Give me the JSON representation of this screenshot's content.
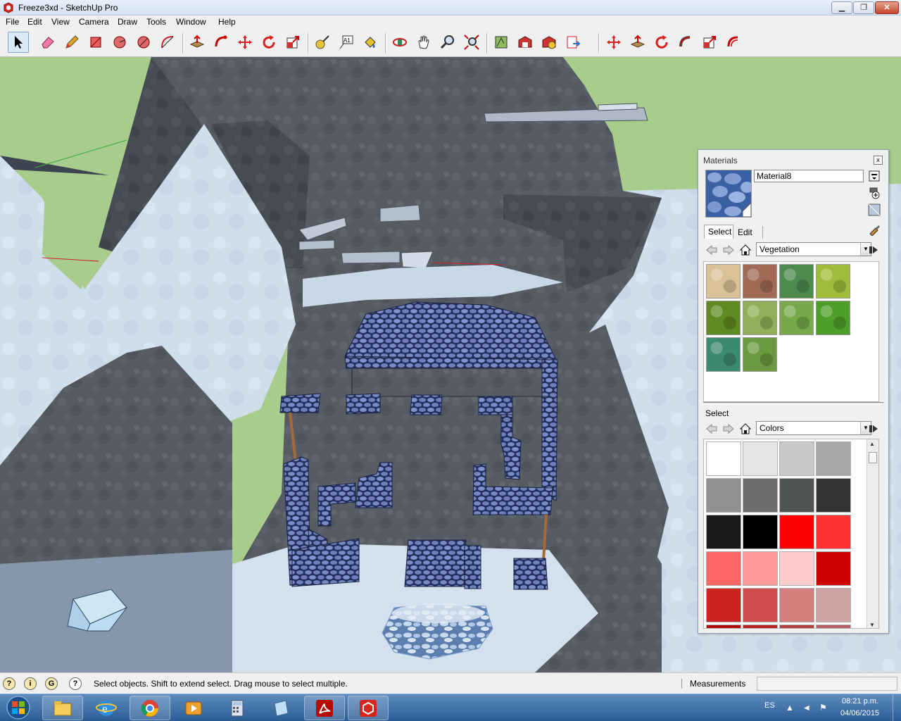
{
  "window": {
    "title": "Freeze3xd - SketchUp Pro",
    "buttons": {
      "minimize": "▁",
      "maximize": "❐",
      "close": "✕"
    }
  },
  "menu": [
    "File",
    "Edit",
    "View",
    "Camera",
    "Draw",
    "Tools",
    "Window",
    "Help"
  ],
  "toolbar": {
    "tools": [
      "select-icon",
      "eraser-icon",
      "pencil-icon",
      "rectangle-icon",
      "circle-icon",
      "arc-icon",
      "arc-2-icon",
      "push-pull-icon",
      "follow-me-icon",
      "move-icon",
      "rotate-icon",
      "scale-icon",
      "tape-measure-icon",
      "text-icon",
      "paint-bucket-icon",
      "orbit-icon",
      "pan-icon",
      "zoom-icon",
      "zoom-extents-icon",
      "geo-location-icon",
      "warehouse-icon",
      "share-model-icon",
      "export-icon",
      "move-2-icon",
      "push-pull-2-icon",
      "rotate-2-icon",
      "follow-me-2-icon",
      "scale-2-icon",
      "offset-icon"
    ]
  },
  "materials": {
    "title": "Materials",
    "close": "x",
    "name": "Material8",
    "tabs": {
      "select": "Select",
      "edit": "Edit"
    },
    "library": "Vegetation",
    "select_label": "Select",
    "colors_library": "Colors",
    "vegetation_swatches": [
      "#d9c298",
      "#a06a54",
      "#4e8a4e",
      "#9fbd3a",
      "#5f8a22",
      "#8fb058",
      "#77a84a",
      "#4e9e2a",
      "#3d8a72",
      "#6b9a40"
    ],
    "color_swatches": [
      "#ffffff",
      "#e6e6e6",
      "#c8c8c8",
      "#a8a8a8",
      "#909090",
      "#6e6e6e",
      "#4f5450",
      "#333333",
      "#171a18",
      "#000000",
      "#ff0000",
      "#ff3333",
      "#ff6666",
      "#ff9999",
      "#ffcccc",
      "#cc0000",
      "#cc2222",
      "#d04c4c",
      "#d47e7e",
      "#cca3a3",
      "#b00000",
      "#b02020",
      "#b04040",
      "#b06060"
    ]
  },
  "status": {
    "hint": "Select objects. Shift to extend select. Drag mouse to select multiple.",
    "measurements_label": "Measurements",
    "measurements_value": "",
    "icons": [
      "geo-icon",
      "credits-icon",
      "account-icon",
      "help-icon"
    ]
  },
  "taskbar": {
    "apps": [
      "file-explorer-icon",
      "internet-explorer-icon",
      "chrome-icon",
      "media-player-icon",
      "calculator-icon",
      "notes-icon",
      "acrobat-icon",
      "sketchup-icon"
    ],
    "language": "ES",
    "time": "08:21 p.m.",
    "date": "04/06/2015"
  }
}
